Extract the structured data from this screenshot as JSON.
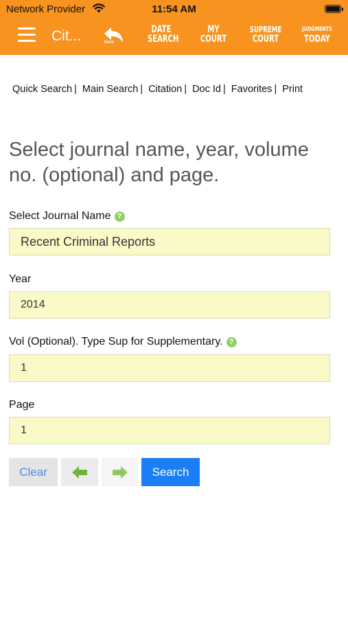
{
  "status_bar": {
    "carrier": "Network Provider",
    "time": "11:54 AM"
  },
  "header": {
    "title": "Cit...",
    "back_label": "BACK",
    "nav": [
      {
        "line1": "DATE",
        "line2": "SEARCH"
      },
      {
        "line1": "MY",
        "line2": "COURT"
      },
      {
        "line1": "SUPREME",
        "line2": "COURT"
      },
      {
        "line1": "JUDGMENTS",
        "line2": "TODAY"
      }
    ],
    "brand_color": "#f7931e"
  },
  "tabs": [
    {
      "label": "Quick Search"
    },
    {
      "label": "Main Search"
    },
    {
      "label": "Citation"
    },
    {
      "label": "Doc Id"
    },
    {
      "label": "Favorites"
    },
    {
      "label": "Print"
    }
  ],
  "tab_separator": "|",
  "heading": "Select journal name, year, volume no. (optional) and page.",
  "form": {
    "journal_label": "Select Journal Name",
    "journal_value": "Recent Criminal Reports",
    "year_label": "Year",
    "year_value": "2014",
    "vol_label": "Vol (Optional). Type Sup for Supplementary.",
    "vol_value": "1",
    "page_label": "Page",
    "page_value": "1",
    "help_glyph": "?"
  },
  "buttons": {
    "clear": "Clear",
    "previous_icon": "arrow-left-icon",
    "next_icon": "arrow-right-icon",
    "search": "Search"
  },
  "colors": {
    "field_bg": "#fafac8",
    "search_btn": "#1a7ef7",
    "arrow_green": "#72b43a",
    "help_green": "#8fd06a"
  }
}
